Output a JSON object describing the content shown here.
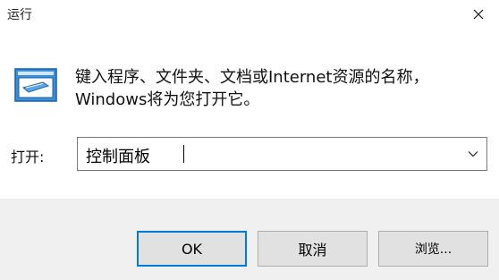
{
  "window": {
    "title": "运行",
    "close_icon": "close-icon"
  },
  "icon": {
    "name": "run-dialog-icon"
  },
  "description": "键入程序、文件夹、文档或Internet资源的名称，Windows将为您打开它。",
  "open": {
    "label": "打开:",
    "value": "控制面板",
    "dropdown_icon": "chevron-down-icon"
  },
  "buttons": {
    "ok": "OK",
    "cancel": "取消",
    "browse": "浏览..."
  },
  "colors": {
    "accent": "#0078d7",
    "footer_bg": "#f0f0f0",
    "button_bg": "#e1e1e1"
  }
}
